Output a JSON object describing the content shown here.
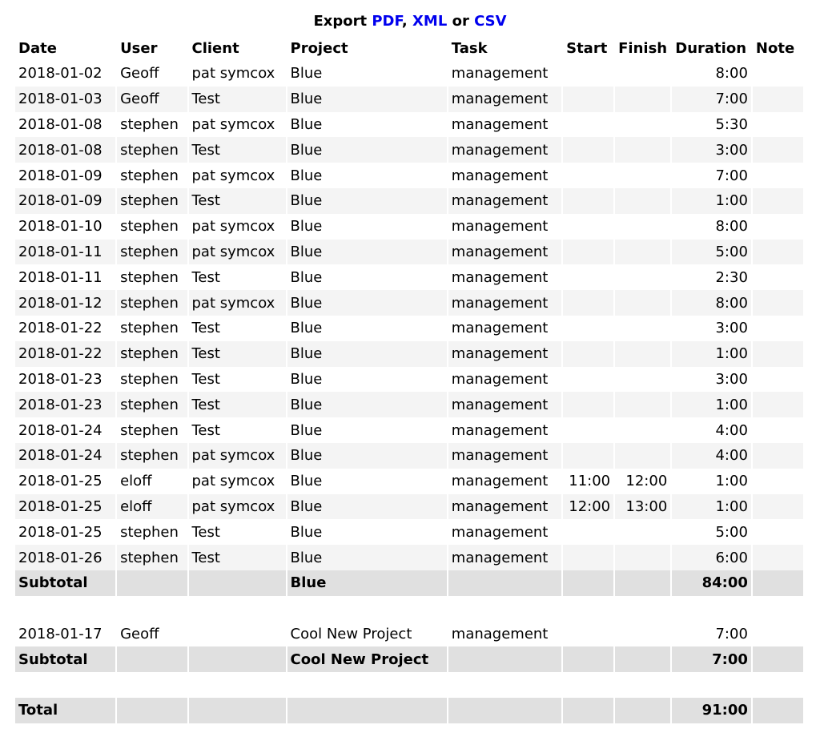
{
  "export": {
    "label": "Export",
    "pdf": "PDF",
    "sep1": ",",
    "xml": "XML",
    "or": "or",
    "csv": "CSV",
    "link_color": "#0000ee"
  },
  "columns": {
    "date": "Date",
    "user": "User",
    "client": "Client",
    "project": "Project",
    "task": "Task",
    "start": "Start",
    "finish": "Finish",
    "duration": "Duration",
    "note": "Note"
  },
  "groups": [
    {
      "rows": [
        {
          "date": "2018-01-02",
          "user": "Geoff",
          "client": "pat symcox",
          "project": "Blue",
          "task": "management",
          "start": "",
          "finish": "",
          "duration": "8:00",
          "note": ""
        },
        {
          "date": "2018-01-03",
          "user": "Geoff",
          "client": "Test",
          "project": "Blue",
          "task": "management",
          "start": "",
          "finish": "",
          "duration": "7:00",
          "note": ""
        },
        {
          "date": "2018-01-08",
          "user": "stephen",
          "client": "pat symcox",
          "project": "Blue",
          "task": "management",
          "start": "",
          "finish": "",
          "duration": "5:30",
          "note": ""
        },
        {
          "date": "2018-01-08",
          "user": "stephen",
          "client": "Test",
          "project": "Blue",
          "task": "management",
          "start": "",
          "finish": "",
          "duration": "3:00",
          "note": ""
        },
        {
          "date": "2018-01-09",
          "user": "stephen",
          "client": "pat symcox",
          "project": "Blue",
          "task": "management",
          "start": "",
          "finish": "",
          "duration": "7:00",
          "note": ""
        },
        {
          "date": "2018-01-09",
          "user": "stephen",
          "client": "Test",
          "project": "Blue",
          "task": "management",
          "start": "",
          "finish": "",
          "duration": "1:00",
          "note": ""
        },
        {
          "date": "2018-01-10",
          "user": "stephen",
          "client": "pat symcox",
          "project": "Blue",
          "task": "management",
          "start": "",
          "finish": "",
          "duration": "8:00",
          "note": ""
        },
        {
          "date": "2018-01-11",
          "user": "stephen",
          "client": "pat symcox",
          "project": "Blue",
          "task": "management",
          "start": "",
          "finish": "",
          "duration": "5:00",
          "note": ""
        },
        {
          "date": "2018-01-11",
          "user": "stephen",
          "client": "Test",
          "project": "Blue",
          "task": "management",
          "start": "",
          "finish": "",
          "duration": "2:30",
          "note": ""
        },
        {
          "date": "2018-01-12",
          "user": "stephen",
          "client": "pat symcox",
          "project": "Blue",
          "task": "management",
          "start": "",
          "finish": "",
          "duration": "8:00",
          "note": ""
        },
        {
          "date": "2018-01-22",
          "user": "stephen",
          "client": "Test",
          "project": "Blue",
          "task": "management",
          "start": "",
          "finish": "",
          "duration": "3:00",
          "note": ""
        },
        {
          "date": "2018-01-22",
          "user": "stephen",
          "client": "Test",
          "project": "Blue",
          "task": "management",
          "start": "",
          "finish": "",
          "duration": "1:00",
          "note": ""
        },
        {
          "date": "2018-01-23",
          "user": "stephen",
          "client": "Test",
          "project": "Blue",
          "task": "management",
          "start": "",
          "finish": "",
          "duration": "3:00",
          "note": ""
        },
        {
          "date": "2018-01-23",
          "user": "stephen",
          "client": "Test",
          "project": "Blue",
          "task": "management",
          "start": "",
          "finish": "",
          "duration": "1:00",
          "note": ""
        },
        {
          "date": "2018-01-24",
          "user": "stephen",
          "client": "Test",
          "project": "Blue",
          "task": "management",
          "start": "",
          "finish": "",
          "duration": "4:00",
          "note": ""
        },
        {
          "date": "2018-01-24",
          "user": "stephen",
          "client": "pat symcox",
          "project": "Blue",
          "task": "management",
          "start": "",
          "finish": "",
          "duration": "4:00",
          "note": ""
        },
        {
          "date": "2018-01-25",
          "user": "eloff",
          "client": "pat symcox",
          "project": "Blue",
          "task": "management",
          "start": "11:00",
          "finish": "12:00",
          "duration": "1:00",
          "note": ""
        },
        {
          "date": "2018-01-25",
          "user": "eloff",
          "client": "pat symcox",
          "project": "Blue",
          "task": "management",
          "start": "12:00",
          "finish": "13:00",
          "duration": "1:00",
          "note": ""
        },
        {
          "date": "2018-01-25",
          "user": "stephen",
          "client": "Test",
          "project": "Blue",
          "task": "management",
          "start": "",
          "finish": "",
          "duration": "5:00",
          "note": ""
        },
        {
          "date": "2018-01-26",
          "user": "stephen",
          "client": "Test",
          "project": "Blue",
          "task": "management",
          "start": "",
          "finish": "",
          "duration": "6:00",
          "note": ""
        }
      ],
      "subtotal": {
        "label": "Subtotal",
        "project": "Blue",
        "duration": "84:00"
      }
    },
    {
      "rows": [
        {
          "date": "2018-01-17",
          "user": "Geoff",
          "client": "",
          "project": "Cool New Project",
          "task": "management",
          "start": "",
          "finish": "",
          "duration": "7:00",
          "note": ""
        }
      ],
      "subtotal": {
        "label": "Subtotal",
        "project": "Cool New Project",
        "duration": "7:00"
      }
    }
  ],
  "total": {
    "label": "Total",
    "duration": "91:00"
  }
}
